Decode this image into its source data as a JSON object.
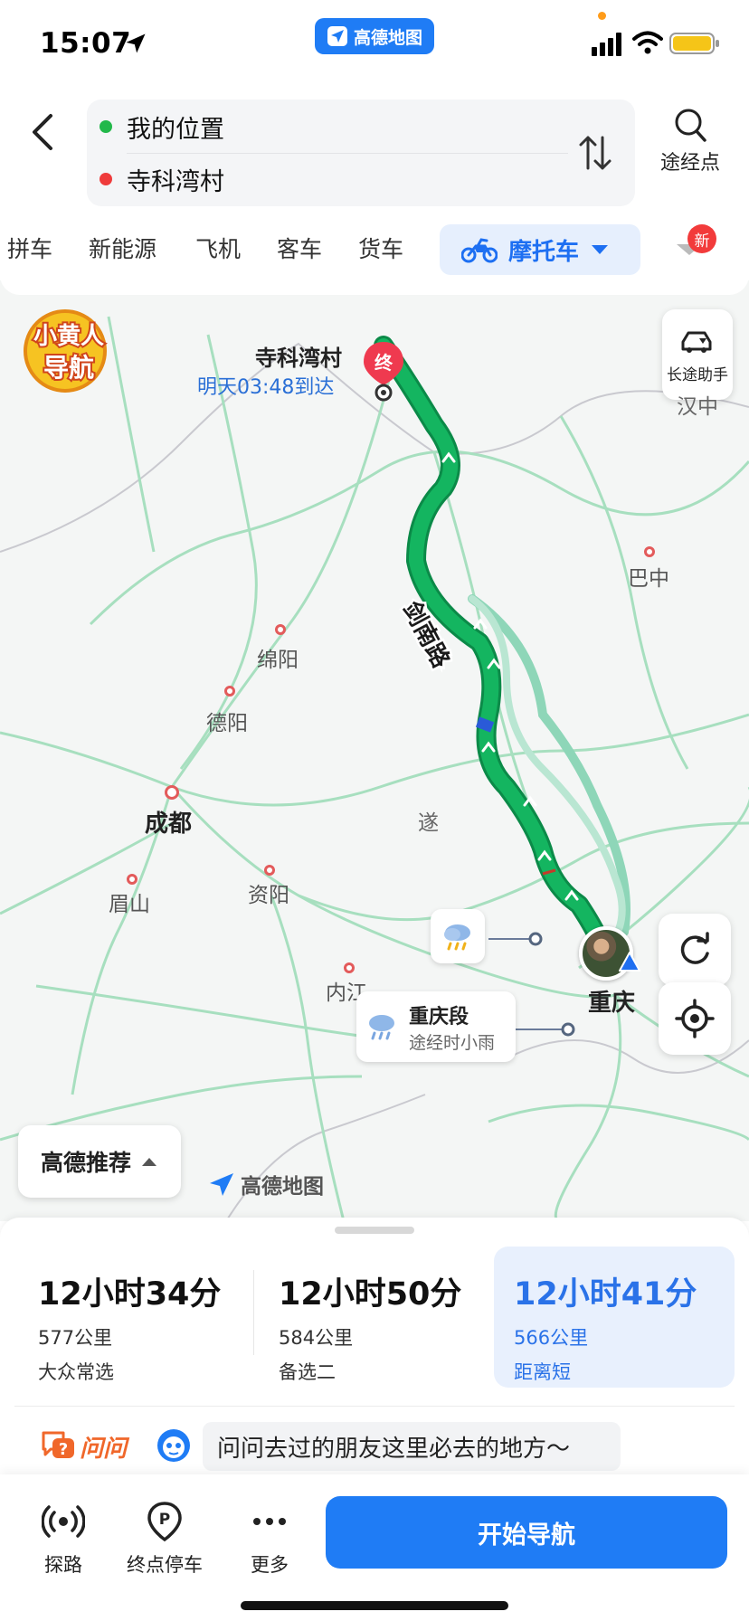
{
  "status_bar": {
    "time": "15:07",
    "app_badge": "高德地图",
    "icons": [
      "location-arrow-icon",
      "signal-icon",
      "wifi-icon",
      "battery-icon"
    ]
  },
  "route": {
    "from": "我的位置",
    "to": "寺科湾村",
    "waypoint_label": "途经点"
  },
  "modes": {
    "tabs": [
      "拼车",
      "新能源",
      "飞机",
      "客车",
      "货车"
    ],
    "active": "摩托车",
    "new_badge": "新"
  },
  "map": {
    "destination_name": "寺科湾村",
    "destination_pin_label": "终",
    "eta": "明天03:48到达",
    "badge_line1": "小黄人",
    "badge_line2": "导航",
    "long_trip_label": "长途助手",
    "road_name": "剑南路",
    "cities": {
      "chengdu": "成都",
      "chongqing": "重庆",
      "mianyang": "绵阳",
      "deyang": "德阳",
      "bazhong": "巴中",
      "meishan": "眉山",
      "ziyang": "资阳",
      "neijiang": "内江",
      "hanzhong_partial": "汉中",
      "sui_partial": "遂"
    },
    "weather": {
      "title": "重庆段",
      "subtitle": "途经时小雨"
    },
    "recommend_label": "高德推荐",
    "watermark": "高德地图",
    "colors": {
      "route_main": "#0fa958",
      "route_alt": "#7fd3b3",
      "accent": "#1f7cf5"
    }
  },
  "options": [
    {
      "time": "12小时34分",
      "distance": "577公里",
      "tag": "大众常选",
      "selected": false
    },
    {
      "time": "12小时50分",
      "distance": "584公里",
      "tag": "备选二",
      "selected": false
    },
    {
      "time": "12小时41分",
      "distance": "566公里",
      "tag": "距离短",
      "selected": true
    }
  ],
  "ask": {
    "logo": "问问",
    "prompt": "问问去过的朋友这里必去的地方～"
  },
  "toolbar": {
    "explore": "探路",
    "parking": "终点停车",
    "more": "更多",
    "start": "开始导航"
  }
}
